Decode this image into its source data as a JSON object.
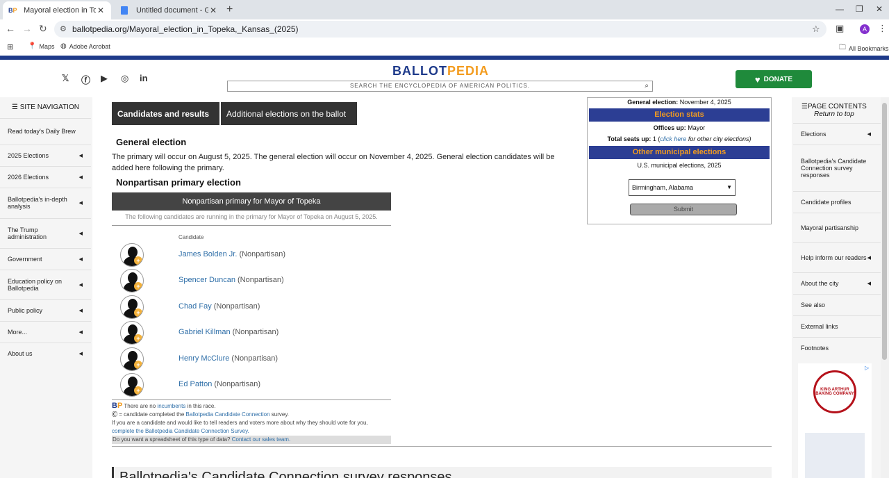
{
  "browser": {
    "tabs": [
      {
        "title": "Mayoral election in Topeka, Kan",
        "favicon": "BP"
      },
      {
        "title": "Untitled document - Google Do",
        "favicon": "docs-icon"
      }
    ],
    "new_tab": "+",
    "url": "ballotpedia.org/Mayoral_election_in_Topeka,_Kansas_(2025)",
    "avatar_letter": "A",
    "bookmarks": [
      "Maps",
      "Adobe Acrobat"
    ],
    "all_bookmarks": "All Bookmarks"
  },
  "site": {
    "logo_part1": "BALLOT",
    "logo_part2": "PEDIA",
    "search_placeholder": "SEARCH THE ENCYCLOPEDIA OF AMERICAN POLITICS.",
    "donate_label": "DONATE",
    "social_icons": [
      "x-icon",
      "facebook-icon",
      "youtube-icon",
      "instagram-icon",
      "linkedin-icon"
    ]
  },
  "leftnav": {
    "header": "SITE NAVIGATION",
    "items": [
      {
        "label": "Read today's Daily Brew",
        "arrow": false
      },
      {
        "label": "2025 Elections",
        "arrow": true
      },
      {
        "label": "2026 Elections",
        "arrow": true
      },
      {
        "label": "Ballotpedia's in-depth analysis",
        "arrow": true
      },
      {
        "label": "The Trump administration",
        "arrow": true
      },
      {
        "label": "Government",
        "arrow": true
      },
      {
        "label": "Education policy on Ballotpedia",
        "arrow": true
      },
      {
        "label": "Public policy",
        "arrow": true
      },
      {
        "label": "More...",
        "arrow": true
      },
      {
        "label": "About us",
        "arrow": true
      }
    ]
  },
  "rightnav": {
    "header": "PAGE CONTENTS",
    "sub": "Return to top",
    "items": [
      {
        "label": "Elections",
        "arrow": true
      },
      {
        "label": "Ballotpedia's Candidate Connection survey responses",
        "arrow": false
      },
      {
        "label": "Candidate profiles",
        "arrow": false
      },
      {
        "label": "Mayoral partisanship",
        "arrow": false
      },
      {
        "label": "Help inform our readers",
        "arrow": true
      },
      {
        "label": "About the city",
        "arrow": true
      },
      {
        "label": "See also",
        "arrow": false
      },
      {
        "label": "External links",
        "arrow": false
      },
      {
        "label": "Footnotes",
        "arrow": false
      }
    ],
    "ad_text": "KING ARTHUR BAKING COMPANY"
  },
  "content": {
    "tab1": "Candidates and results",
    "tab2": "Additional elections on the ballot",
    "general_heading": "General election",
    "general_text": "The primary will occur on August 5, 2025. The general election will occur on November 4, 2025. General election candidates will be added here following the primary.",
    "primary_heading": "Nonpartisan primary election",
    "table_title": "Nonpartisan primary for Mayor of Topeka",
    "table_note": "The following candidates are running in the primary for Mayor of Topeka on August 5, 2025.",
    "candidate_header": "Candidate",
    "candidates": [
      {
        "name": "James Bolden Jr.",
        "party": "(Nonpartisan)"
      },
      {
        "name": "Spencer Duncan",
        "party": "(Nonpartisan)"
      },
      {
        "name": "Chad Fay",
        "party": "(Nonpartisan)"
      },
      {
        "name": "Gabriel Killman",
        "party": "(Nonpartisan)"
      },
      {
        "name": "Henry McClure",
        "party": "(Nonpartisan)"
      },
      {
        "name": "Ed Patton",
        "party": "(Nonpartisan)"
      }
    ],
    "foot1_a": "There are no",
    "foot1_link": "incumbents",
    "foot1_b": "in this race.",
    "foot2_a": "= candidate completed the",
    "foot2_link": "Ballotpedia Candidate Connection",
    "foot2_b": "survey.",
    "foot3_a": "If you are a candidate and would like to tell readers and voters more about why they should vote for you,",
    "foot3_link": "complete the Ballotpedia Candidate Connection Survey.",
    "foot4_a": "Do you want a spreadsheet of this type of data?",
    "foot4_link": "Contact our sales team.",
    "next_heading": "Ballotpedia's Candidate Connection survey responses"
  },
  "infobox": {
    "general_label": "General election:",
    "general_value": "November 4, 2025",
    "stats_bar": "Election stats",
    "offices_label": "Offices up:",
    "offices_value": "Mayor",
    "seats_label": "Total seats up:",
    "seats_value": "1 (",
    "seats_link": "click here",
    "seats_rest": "for other city elections)",
    "other_bar": "Other municipal elections",
    "other_link": "U.S. municipal elections, 2025",
    "select_value": "Birmingham, Alabama",
    "submit": "Submit"
  }
}
